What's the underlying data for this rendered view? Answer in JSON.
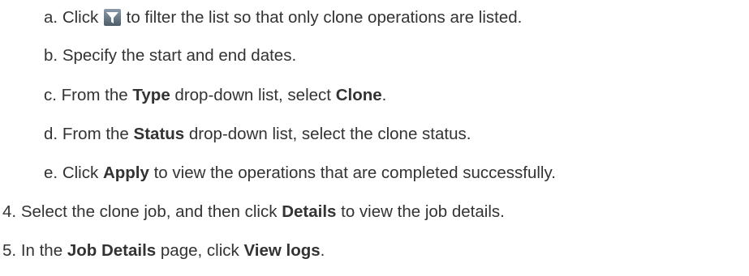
{
  "icons": {
    "filter": "filter-icon"
  },
  "colors": {
    "text": "#333333",
    "filter_icon_bg_top": "#8a9aa8",
    "filter_icon_bg_bottom": "#4f5d6a",
    "filter_icon_funnel": "#ffffff"
  },
  "steps": {
    "a": {
      "marker": "a.",
      "t1": "Click",
      "t2": "to filter the list so that only clone operations are listed."
    },
    "b": {
      "marker": "b.",
      "t1": "Specify the start and end dates."
    },
    "c": {
      "marker": "c.",
      "t1": "From the",
      "b1": "Type",
      "t2": "drop-down list, select",
      "b2": "Clone",
      "t3": "."
    },
    "d": {
      "marker": "d.",
      "t1": "From the",
      "b1": "Status",
      "t2": "drop-down list, select the clone status."
    },
    "e": {
      "marker": "e.",
      "t1": "Click",
      "b1": "Apply",
      "t2": "to view the operations that are completed successfully."
    },
    "s4": {
      "marker": "4.",
      "t1": "Select the clone job, and then click",
      "b1": "Details",
      "t2": "to view the job details."
    },
    "s5": {
      "marker": "5.",
      "t1": "In the",
      "b1": "Job Details",
      "t2": "page, click",
      "b2": "View logs",
      "t3": "."
    }
  }
}
